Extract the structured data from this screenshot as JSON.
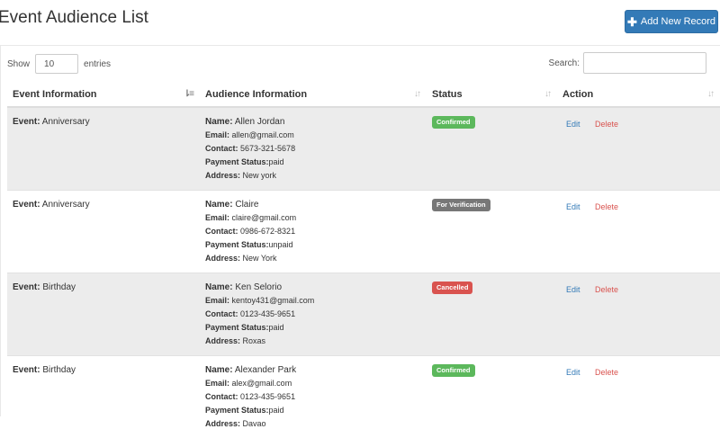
{
  "header": {
    "title": "Event Audience List",
    "add_button_label": "Add New Record",
    "add_button_color": "#337ab7"
  },
  "controls": {
    "show_label": "Show",
    "page_length": "10",
    "entries_label": "entries",
    "search_label": "Search:"
  },
  "table": {
    "columns": [
      "Event Information",
      "Audience Information",
      "Status",
      "Action"
    ],
    "rows": [
      {
        "event_label": "Event:",
        "event": "Anniversary",
        "name_label": "Name:",
        "name": "Allen Jordan",
        "email_label": "Email:",
        "email": "allen@gmail.com",
        "contact_label": "Contact:",
        "contact": "5673-321-5678",
        "payment_label": "Payment Status:",
        "payment": "paid",
        "address_label": "Address:",
        "address": "New york",
        "status": "Confirmed",
        "status_color": "#5cb85c",
        "edit": "Edit",
        "delete": "Delete"
      },
      {
        "event_label": "Event:",
        "event": "Anniversary",
        "name_label": "Name:",
        "name": "Claire",
        "email_label": "Email:",
        "email": "claire@gmail.com",
        "contact_label": "Contact:",
        "contact": "0986-672-8321",
        "payment_label": "Payment Status:",
        "payment": "unpaid",
        "address_label": "Address:",
        "address": "New York",
        "status": "For Verification",
        "status_color": "#777777",
        "edit": "Edit",
        "delete": "Delete"
      },
      {
        "event_label": "Event:",
        "event": "Birthday",
        "name_label": "Name:",
        "name": "Ken Selorio",
        "email_label": "Email:",
        "email": "kentoy431@gmail.com",
        "contact_label": "Contact:",
        "contact": "0123-435-9651",
        "payment_label": "Payment Status:",
        "payment": "paid",
        "address_label": "Address:",
        "address": "Roxas",
        "status": "Cancelled",
        "status_color": "#d9534f",
        "edit": "Edit",
        "delete": "Delete"
      },
      {
        "event_label": "Event:",
        "event": "Birthday",
        "name_label": "Name:",
        "name": "Alexander Park",
        "email_label": "Email:",
        "email": "alex@gmail.com",
        "contact_label": "Contact:",
        "contact": "0123-435-9651",
        "payment_label": "Payment Status:",
        "payment": "paid",
        "address_label": "Address:",
        "address": "Davao",
        "status": "Confirmed",
        "status_color": "#5cb85c",
        "edit": "Edit",
        "delete": "Delete"
      }
    ]
  },
  "icons": {
    "plus": "plus-icon",
    "sort_active": "sort-amount-icon",
    "sort": "sort-icon"
  }
}
